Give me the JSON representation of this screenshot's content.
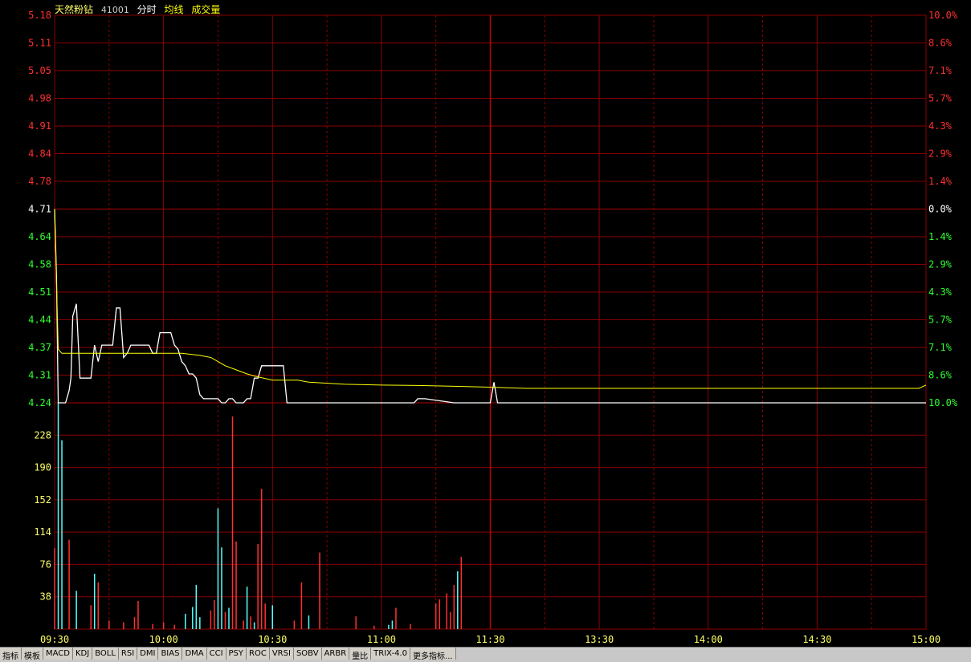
{
  "header": {
    "name": "天然粉钻",
    "code": "41001",
    "mode": "分时",
    "avg_label": "均线",
    "vol_label": "成交量"
  },
  "colors": {
    "up": "#ff3030",
    "down": "#30ff30",
    "neutral": "#ffffff",
    "grid": "#8b0000",
    "price_line": "#ffffff",
    "avg_line": "#ffff00",
    "vol_up": "#ff3030",
    "vol_down": "#54ffff"
  },
  "chart_data": {
    "type": "line",
    "prev_close": 4.71,
    "price_axis": {
      "ticks": [
        "5.18",
        "5.11",
        "5.05",
        "4.98",
        "4.91",
        "4.84",
        "4.78",
        "4.71",
        "4.64",
        "4.58",
        "4.51",
        "4.44",
        "4.37",
        "4.31",
        "4.24"
      ],
      "pct_ticks": [
        "10.0%",
        "8.6%",
        "7.1%",
        "5.7%",
        "4.3%",
        "2.9%",
        "1.4%",
        "0.0%",
        "1.4%",
        "2.9%",
        "4.3%",
        "5.7%",
        "7.1%",
        "8.6%",
        "10.0%"
      ],
      "ylim": [
        4.24,
        5.18
      ]
    },
    "volume_axis": {
      "ticks": [
        "228",
        "190",
        "152",
        "114",
        "76",
        "38"
      ],
      "ylim": [
        0,
        266
      ]
    },
    "time_axis": {
      "ticks": [
        "09:30",
        "10:00",
        "10:30",
        "11:00",
        "11:30",
        "13:30",
        "14:00",
        "14:30",
        "15:00"
      ],
      "range_minutes": [
        0,
        240
      ]
    },
    "series": [
      {
        "key": "price",
        "x": [
          0,
          0.5,
          1,
          1.5,
          2,
          3,
          4,
          4.5,
          5,
          6,
          7,
          8,
          9,
          10,
          11,
          12,
          13,
          14,
          15,
          16,
          17,
          18,
          19,
          20,
          21,
          22,
          23,
          24,
          25,
          26,
          27,
          28,
          29,
          30,
          31,
          32,
          33,
          34,
          35,
          36,
          37,
          38,
          39,
          40,
          41,
          42,
          43,
          44,
          45,
          46,
          47,
          48,
          49,
          50,
          51,
          52,
          53,
          54,
          55,
          56,
          57,
          58,
          59,
          60,
          61,
          62,
          63,
          64,
          65,
          66,
          67,
          68,
          69,
          70,
          71,
          72,
          73,
          80,
          90,
          95,
          99,
          100,
          101,
          102,
          110,
          120,
          121,
          122,
          240
        ],
        "values": [
          4.71,
          4.55,
          4.24,
          4.24,
          4.24,
          4.24,
          4.27,
          4.3,
          4.45,
          4.48,
          4.3,
          4.3,
          4.3,
          4.3,
          4.38,
          4.34,
          4.38,
          4.38,
          4.38,
          4.38,
          4.47,
          4.47,
          4.35,
          4.36,
          4.38,
          4.38,
          4.38,
          4.38,
          4.38,
          4.38,
          4.36,
          4.36,
          4.41,
          4.41,
          4.41,
          4.41,
          4.38,
          4.37,
          4.34,
          4.33,
          4.31,
          4.31,
          4.3,
          4.26,
          4.25,
          4.25,
          4.25,
          4.25,
          4.25,
          4.24,
          4.24,
          4.25,
          4.25,
          4.24,
          4.24,
          4.24,
          4.25,
          4.25,
          4.3,
          4.3,
          4.33,
          4.33,
          4.33,
          4.33,
          4.33,
          4.33,
          4.33,
          4.24,
          4.24,
          4.24,
          4.24,
          4.24,
          4.24,
          4.24,
          4.24,
          4.24,
          4.24,
          4.24,
          4.24,
          4.24,
          4.24,
          4.25,
          4.25,
          4.25,
          4.24,
          4.24,
          4.29,
          4.24,
          4.24
        ]
      },
      {
        "key": "avg",
        "x": [
          0,
          1,
          2,
          5,
          10,
          20,
          30,
          35,
          40,
          43,
          45,
          47,
          50,
          53,
          55,
          60,
          67,
          70,
          80,
          90,
          100,
          110,
          120,
          130,
          160,
          200,
          238,
          240
        ],
        "values": [
          4.71,
          4.37,
          4.36,
          4.36,
          4.36,
          4.36,
          4.36,
          4.36,
          4.355,
          4.35,
          4.34,
          4.33,
          4.32,
          4.31,
          4.305,
          4.295,
          4.295,
          4.29,
          4.285,
          4.283,
          4.282,
          4.28,
          4.278,
          4.275,
          4.275,
          4.275,
          4.275,
          4.283
        ]
      }
    ],
    "volumes": [
      {
        "t": 0,
        "v": 95,
        "up": true
      },
      {
        "t": 1,
        "v": 266,
        "up": false
      },
      {
        "t": 2,
        "v": 222,
        "up": false
      },
      {
        "t": 4,
        "v": 105,
        "up": true
      },
      {
        "t": 6,
        "v": 45,
        "up": false
      },
      {
        "t": 10,
        "v": 28,
        "up": true
      },
      {
        "t": 11,
        "v": 65,
        "up": false
      },
      {
        "t": 12,
        "v": 55,
        "up": true
      },
      {
        "t": 15,
        "v": 10,
        "up": true
      },
      {
        "t": 19,
        "v": 8,
        "up": true
      },
      {
        "t": 22,
        "v": 14,
        "up": true
      },
      {
        "t": 23,
        "v": 33,
        "up": true
      },
      {
        "t": 27,
        "v": 6,
        "up": true
      },
      {
        "t": 30,
        "v": 8,
        "up": true
      },
      {
        "t": 33,
        "v": 5,
        "up": true
      },
      {
        "t": 36,
        "v": 18,
        "up": false
      },
      {
        "t": 38,
        "v": 26,
        "up": false
      },
      {
        "t": 39,
        "v": 52,
        "up": false
      },
      {
        "t": 40,
        "v": 14,
        "up": false
      },
      {
        "t": 43,
        "v": 22,
        "up": true
      },
      {
        "t": 44,
        "v": 34,
        "up": true
      },
      {
        "t": 45,
        "v": 142,
        "up": false
      },
      {
        "t": 46,
        "v": 96,
        "up": false
      },
      {
        "t": 47,
        "v": 20,
        "up": true
      },
      {
        "t": 48,
        "v": 25,
        "up": false
      },
      {
        "t": 49,
        "v": 250,
        "up": true
      },
      {
        "t": 50,
        "v": 103,
        "up": true
      },
      {
        "t": 52,
        "v": 10,
        "up": true
      },
      {
        "t": 53,
        "v": 50,
        "up": false
      },
      {
        "t": 54,
        "v": 15,
        "up": true
      },
      {
        "t": 55,
        "v": 8,
        "up": false
      },
      {
        "t": 56,
        "v": 100,
        "up": true
      },
      {
        "t": 57,
        "v": 165,
        "up": true
      },
      {
        "t": 58,
        "v": 30,
        "up": true
      },
      {
        "t": 60,
        "v": 28,
        "up": false
      },
      {
        "t": 66,
        "v": 10,
        "up": true
      },
      {
        "t": 68,
        "v": 55,
        "up": true
      },
      {
        "t": 70,
        "v": 16,
        "up": false
      },
      {
        "t": 73,
        "v": 90,
        "up": true
      },
      {
        "t": 83,
        "v": 15,
        "up": true
      },
      {
        "t": 88,
        "v": 4,
        "up": true
      },
      {
        "t": 92,
        "v": 5,
        "up": false
      },
      {
        "t": 93,
        "v": 10,
        "up": false
      },
      {
        "t": 94,
        "v": 25,
        "up": true
      },
      {
        "t": 98,
        "v": 6,
        "up": true
      },
      {
        "t": 105,
        "v": 30,
        "up": true
      },
      {
        "t": 106,
        "v": 35,
        "up": true
      },
      {
        "t": 108,
        "v": 42,
        "up": true
      },
      {
        "t": 109,
        "v": 20,
        "up": true
      },
      {
        "t": 110,
        "v": 52,
        "up": true
      },
      {
        "t": 111,
        "v": 68,
        "up": false
      },
      {
        "t": 112,
        "v": 85,
        "up": true
      }
    ]
  }
}
